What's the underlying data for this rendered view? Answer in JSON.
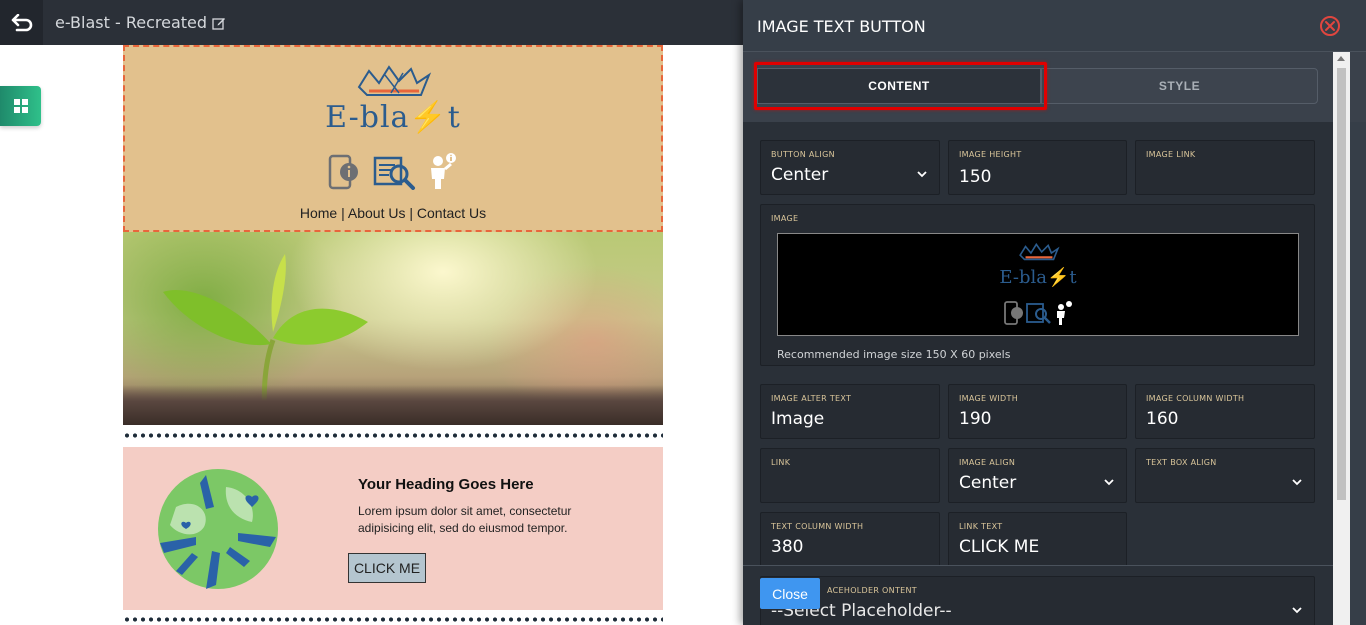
{
  "topbar": {
    "title": "e-Blast - Recreated"
  },
  "email": {
    "logo_text": "E-bla⚡t",
    "nav": {
      "home": "Home",
      "about": "About Us",
      "contact": "Contact Us",
      "separator": " | "
    },
    "content_block": {
      "heading": "Your Heading Goes Here",
      "body": "Lorem ipsum dolor sit amet, consectetur adipisicing elit, sed do eiusmod tempor.",
      "button_label": "CLICK ME"
    }
  },
  "panel": {
    "title": "IMAGE TEXT BUTTON",
    "tabs": [
      {
        "label": "CONTENT",
        "active": true
      },
      {
        "label": "STYLE",
        "active": false
      }
    ],
    "fields": {
      "button_align": {
        "label": "BUTTON ALIGN",
        "value": "Center"
      },
      "image_height": {
        "label": "IMAGE HEIGHT",
        "value": "150"
      },
      "image_link": {
        "label": "IMAGE LINK",
        "value": ""
      },
      "image": {
        "label": "IMAGE",
        "note": "Recommended image size 150 X 60 pixels",
        "preview_logo_text": "E-bla⚡t"
      },
      "image_alter_text": {
        "label": "IMAGE ALTER TEXT",
        "value": "Image"
      },
      "image_width": {
        "label": "IMAGE WIDTH",
        "value": "190"
      },
      "image_column_width": {
        "label": "IMAGE COLUMN WIDTH",
        "value": "160"
      },
      "link": {
        "label": "LINK",
        "value": ""
      },
      "image_align": {
        "label": "IMAGE ALIGN",
        "value": "Center"
      },
      "text_box_align": {
        "label": "TEXT BOX ALIGN",
        "value": ""
      },
      "text_column_width": {
        "label": "TEXT COLUMN WIDTH",
        "value": "380"
      },
      "link_text": {
        "label": "LINK TEXT",
        "value": "CLICK ME"
      },
      "placeholder": {
        "label": "ACEHOLDER ONTENT",
        "value": "--Select Placeholder--"
      }
    },
    "close_label": "Close"
  },
  "colors": {
    "accent_highlight": "#e00000",
    "close_button": "#3f96f0",
    "header_block_bg": "#e2c18d",
    "content_block_bg": "#f4cdc5"
  }
}
